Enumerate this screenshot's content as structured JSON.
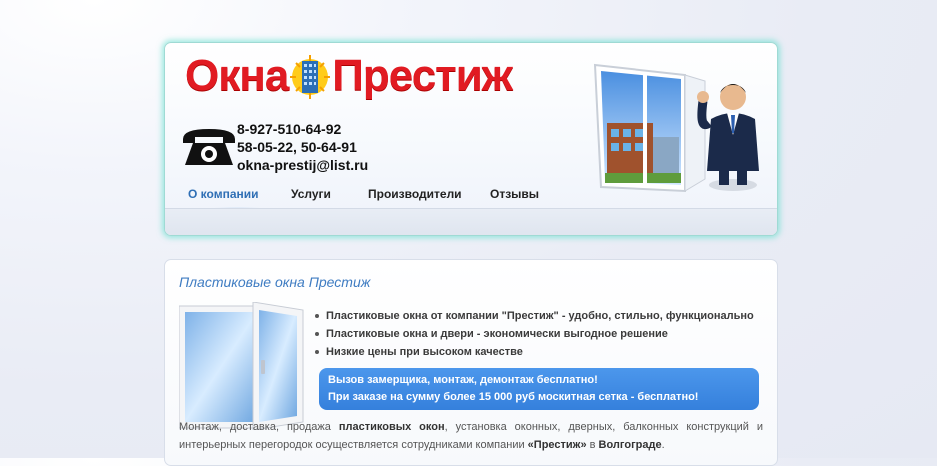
{
  "header": {
    "logo": {
      "word1": "Окна",
      "word2": "Престиж"
    },
    "contacts": {
      "phone1": "8-927-510-64-92",
      "phone2": "58-05-22, 50-64-91",
      "email": "okna-prestij@list.ru"
    },
    "nav": [
      {
        "label": "О компании",
        "active": true
      },
      {
        "label": "Услуги",
        "active": false
      },
      {
        "label": "Производители",
        "active": false
      },
      {
        "label": "Отзывы",
        "active": false
      }
    ]
  },
  "content": {
    "title": "Пластиковые окна Престиж",
    "bullets": [
      "Пластиковые окна от компании \"Престиж\" - удобно, стильно, функционально",
      "Пластиковые окна и двери - экономически выгодное решение",
      "Низкие цены при высоком качестве"
    ],
    "promo": {
      "line1": "Вызов замерщика, монтаж, демонтаж бесплатно!",
      "line2": "При заказе на сумму более 15 000 руб москитная сетка - бесплатно!"
    },
    "paragraph": {
      "part1": "Монтаж, доставка, продажа ",
      "bold1": "пластиковых окон",
      "part2": ", установка оконных, дверных, балконных конструкций и интерьерных перегородок осуществляется сотрудниками компании ",
      "bold2": "«Престиж»",
      "part3": " в ",
      "bold3": "Волгограде",
      "part4": "."
    }
  },
  "colors": {
    "brand_red": "#e11b22",
    "accent_blue": "#3f7cc2",
    "promo_blue": "#3580dc",
    "header_glow": "#50dcc8"
  }
}
